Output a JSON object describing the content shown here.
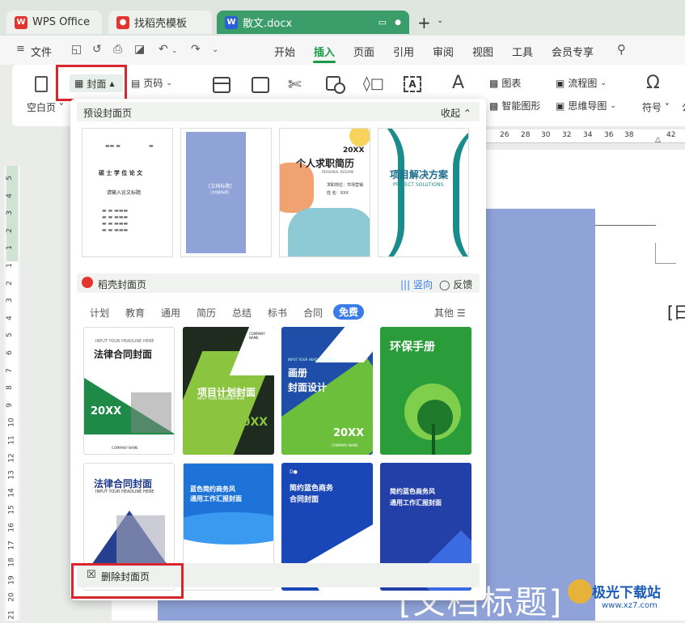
{
  "tabs": [
    {
      "label": "WPS Office"
    },
    {
      "label": "找稻壳模板"
    },
    {
      "label": "散文.docx"
    }
  ],
  "menu": {
    "file": "文件",
    "items": [
      "开始",
      "插入",
      "页面",
      "引用",
      "审阅",
      "视图",
      "工具",
      "会员专享"
    ],
    "active": "插入"
  },
  "ribbon": {
    "blank_page": "空白页",
    "cover": "封面",
    "page_number": "页码",
    "chart": "图表",
    "smart_shape": "智能图形",
    "flowchart": "流程图",
    "mindmap": "思维导图",
    "symbol": "符号"
  },
  "ruler": {
    "top_ticks": [
      "26",
      "28",
      "30",
      "32",
      "34",
      "36",
      "38",
      "42"
    ],
    "left_ticks": [
      "5",
      "4",
      "3",
      "2",
      "1",
      "1",
      "2",
      "3",
      "4",
      "5",
      "6",
      "7",
      "8",
      "9",
      "10",
      "11",
      "12",
      "13",
      "14",
      "15",
      "16",
      "17",
      "18",
      "19",
      "20",
      "21"
    ]
  },
  "panel": {
    "preset_title": "预设封面页",
    "collapse": "收起",
    "docer_title": "稻壳封面页",
    "vertical": "竖向",
    "feedback": "反馈",
    "categories": [
      "计划",
      "教育",
      "通用",
      "简历",
      "总结",
      "标书",
      "合同",
      "免费"
    ],
    "active_category": "免费",
    "other": "其他",
    "delete_cover": "删除封面页"
  },
  "preset_cards": {
    "c1": {
      "line1": "硕 士 学 位 论 文",
      "line2": "请输入论文标题"
    },
    "c2": {
      "title": "[文档标题]",
      "sub": "[文档副标题]"
    },
    "c3": {
      "year": "20XX",
      "title": "个人求职简历",
      "sub": "PERSONAL RESUME",
      "f1": "求职岗位：市场营销",
      "f2": "姓    名：XXX"
    },
    "c4": {
      "title": "项目解决方案",
      "sub": "PROJECT SOLUTIONS"
    }
  },
  "docer_cards": {
    "d1": {
      "eng": "INPUT YOUR HEADLINE HERE",
      "title": "法律合同封面",
      "year": "20XX",
      "company": "COMPANY NAME"
    },
    "d2": {
      "company": "COMPANY NAME",
      "title": "项目计划封面",
      "eng": "INPUT YOUR HEADLINE HERE",
      "year": "20XX"
    },
    "d3": {
      "eng": "INPUT YOUR HEADLINE HERE",
      "title1": "画册",
      "title2": "封面设计",
      "year": "20XX",
      "company": "COMPANY NAME"
    },
    "d4": {
      "title": "环保手册"
    },
    "d5": {
      "title": "法律合同封面",
      "eng": "INPUT YOUR HEADLINE HERE"
    },
    "d6": {
      "title1": "蓝色简约商务风",
      "title2": "通用工作汇报封面"
    },
    "d7": {
      "title1": "简约蓝色商务",
      "title2": "合同封面"
    },
    "d8": {
      "title1": "简约蓝色商务风",
      "title2": "通用工作汇报封面"
    }
  },
  "document": {
    "bracket_text": "[日",
    "title_text": "[文档标题]"
  },
  "watermark": {
    "cn": "极光下载站",
    "url": "www.xz7.com"
  },
  "colors": {
    "accent": "#1a9b4a",
    "highlight": "#d9262e",
    "select_blue": "#3a7be8"
  }
}
